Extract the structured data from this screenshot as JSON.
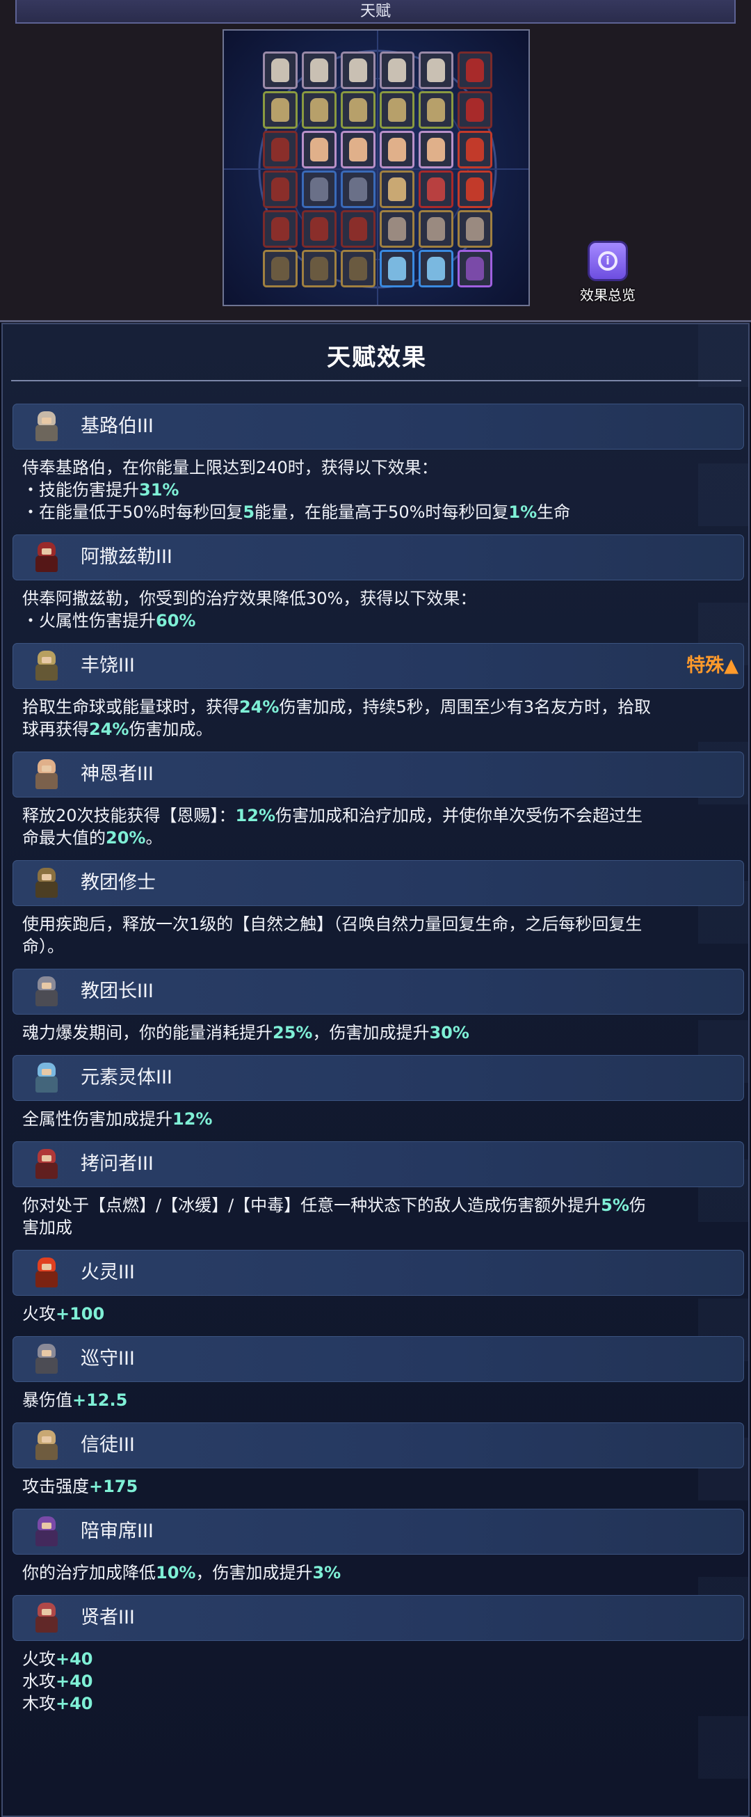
{
  "header": {
    "title": "天赋"
  },
  "summary_button": {
    "label": "效果总览"
  },
  "board": {
    "rows": [
      [
        "#c9c0b3",
        "#c9c0b3",
        "#c9c0b3",
        "#c9c0b3",
        "#c9c0b3",
        "#a82a2a"
      ],
      [
        "#b7a06a",
        "#b7a06a",
        "#b7a06a",
        "#b7a06a",
        "#b7a06a",
        "#a82a2a"
      ],
      [
        "#8a2e2a",
        "#e0b08a",
        "#e0b08a",
        "#e0b08a",
        "#e0b08a",
        "#c23a2a"
      ],
      [
        "#8a2e2a",
        "#6a7088",
        "#6a7088",
        "#c9a873",
        "#b84040",
        "#c23a2a"
      ],
      [
        "#8a2e2a",
        "#8a2e2a",
        "#8a2e2a",
        "#9a8a80",
        "#9a8a80",
        "#9a8a80"
      ],
      [
        "#6a5a40",
        "#6a5a40",
        "#6a5a40",
        "#7ab8e0",
        "#7ab8e0",
        "#7a4aa8"
      ]
    ],
    "frames": [
      [
        "#9a8aa8",
        "#9a8aa8",
        "#9a8aa8",
        "#9a8aa8",
        "#9a8aa8",
        "#7a2a2a"
      ],
      [
        "#8a9a40",
        "#8a9a40",
        "#8a9a40",
        "#8a9a40",
        "#8a9a40",
        "#7a2a2a"
      ],
      [
        "#7a2a2a",
        "#b890c8",
        "#b890c8",
        "#b890c8",
        "#b890c8",
        "#c23a2a"
      ],
      [
        "#7a2a2a",
        "#3a6ab8",
        "#3a6ab8",
        "#a08040",
        "#a82a2a",
        "#c23a2a"
      ],
      [
        "#7a2a2a",
        "#7a2a2a",
        "#7a2a2a",
        "#a08040",
        "#a08040",
        "#a08040"
      ],
      [
        "#a08040",
        "#a08040",
        "#a08040",
        "#3a8ae0",
        "#3a8ae0",
        "#a060e0"
      ]
    ]
  },
  "panel": {
    "title": "天赋效果",
    "entries": [
      {
        "name": "基路伯III",
        "icon": "cherub-icon",
        "color": "#c7b9a8",
        "lines": [
          [
            {
              "t": "侍奉基路伯，在你能量上限达到240时，获得以下效果："
            }
          ],
          [
            {
              "t": "・技能伤害提升"
            },
            {
              "t": "31%",
              "h": 1
            }
          ],
          [
            {
              "t": "・在能量低于50%时每秒回复"
            },
            {
              "t": "5",
              "h": 1
            },
            {
              "t": "能量，在能量高于50%时每秒回复"
            },
            {
              "t": "1%",
              "h": 1
            },
            {
              "t": "生命"
            }
          ]
        ]
      },
      {
        "name": "阿撒兹勒III",
        "icon": "azazel-icon",
        "color": "#9a2a2a",
        "lines": [
          [
            {
              "t": "供奉阿撒兹勒，你受到的治疗效果降低30%，获得以下效果："
            }
          ],
          [
            {
              "t": "・火属性伤害提升"
            },
            {
              "t": "60%",
              "h": 1
            }
          ]
        ]
      },
      {
        "name": "丰饶III",
        "icon": "abundance-icon",
        "color": "#b8a060",
        "tag": "特殊▲",
        "lines": [
          [
            {
              "t": "拾取生命球或能量球时，获得"
            },
            {
              "t": "24%",
              "h": 1
            },
            {
              "t": "伤害加成，持续5秒，周围至少有3名友方时，拾取"
            }
          ],
          [
            {
              "t": "球再获得"
            },
            {
              "t": "24%",
              "h": 1
            },
            {
              "t": "伤害加成。"
            }
          ]
        ]
      },
      {
        "name": "神恩者III",
        "icon": "grace-icon",
        "color": "#e0b08a",
        "lines": [
          [
            {
              "t": "释放20次技能获得【恩赐】："
            },
            {
              "t": "12%",
              "h": 1
            },
            {
              "t": "伤害加成和治疗加成，并使你单次受伤不会超过生"
            }
          ],
          [
            {
              "t": "命最大值的"
            },
            {
              "t": "20%",
              "h": 1
            },
            {
              "t": "。"
            }
          ]
        ]
      },
      {
        "name": "教团修士",
        "icon": "monk-icon",
        "color": "#8a7040",
        "lines": [
          [
            {
              "t": "使用疾跑后，释放一次1级的【自然之触】（召唤自然力量回复生命，之后每秒回复生"
            }
          ],
          [
            {
              "t": "命）。"
            }
          ]
        ]
      },
      {
        "name": "教团长III",
        "icon": "order-leader-icon",
        "color": "#8a8a98",
        "lines": [
          [
            {
              "t": "魂力爆发期间，你的能量消耗提升"
            },
            {
              "t": "25%",
              "h": 1
            },
            {
              "t": "，伤害加成提升"
            },
            {
              "t": "30%",
              "h": 1
            }
          ]
        ]
      },
      {
        "name": "元素灵体III",
        "icon": "elemental-icon",
        "color": "#7ab8e0",
        "lines": [
          [
            {
              "t": "全属性伤害加成提升"
            },
            {
              "t": "12%",
              "h": 1
            }
          ]
        ]
      },
      {
        "name": "拷问者III",
        "icon": "inquisitor-icon",
        "color": "#b03838",
        "lines": [
          [
            {
              "t": "你对处于【点燃】/【冰缓】/【中毒】任意一种状态下的敌人造成伤害额外提升"
            },
            {
              "t": "5%",
              "h": 1
            },
            {
              "t": "伤"
            }
          ],
          [
            {
              "t": "害加成"
            }
          ]
        ]
      },
      {
        "name": "火灵III",
        "icon": "fire-spirit-icon",
        "color": "#e04020",
        "lines": [
          [
            {
              "t": "火攻"
            },
            {
              "t": "+100",
              "h": 1
            }
          ]
        ]
      },
      {
        "name": "巡守III",
        "icon": "warden-icon",
        "color": "#8a8a98",
        "lines": [
          [
            {
              "t": "暴伤值"
            },
            {
              "t": "+12.5",
              "h": 1
            }
          ]
        ]
      },
      {
        "name": "信徒III",
        "icon": "believer-icon",
        "color": "#c9a873",
        "lines": [
          [
            {
              "t": "攻击强度"
            },
            {
              "t": "+175",
              "h": 1
            }
          ]
        ]
      },
      {
        "name": "陪审席III",
        "icon": "juror-icon",
        "color": "#7a4aa8",
        "lines": [
          [
            {
              "t": "你的治疗加成降低"
            },
            {
              "t": "10%",
              "h": 1
            },
            {
              "t": "，伤害加成提升"
            },
            {
              "t": "3%",
              "h": 1
            }
          ]
        ]
      },
      {
        "name": "贤者III",
        "icon": "sage-icon",
        "color": "#b04848",
        "lines": [
          [
            {
              "t": "火攻"
            },
            {
              "t": "+40",
              "h": 1
            }
          ],
          [
            {
              "t": "水攻"
            },
            {
              "t": "+40",
              "h": 1
            }
          ],
          [
            {
              "t": "木攻"
            },
            {
              "t": "+40",
              "h": 1
            }
          ]
        ]
      }
    ]
  }
}
